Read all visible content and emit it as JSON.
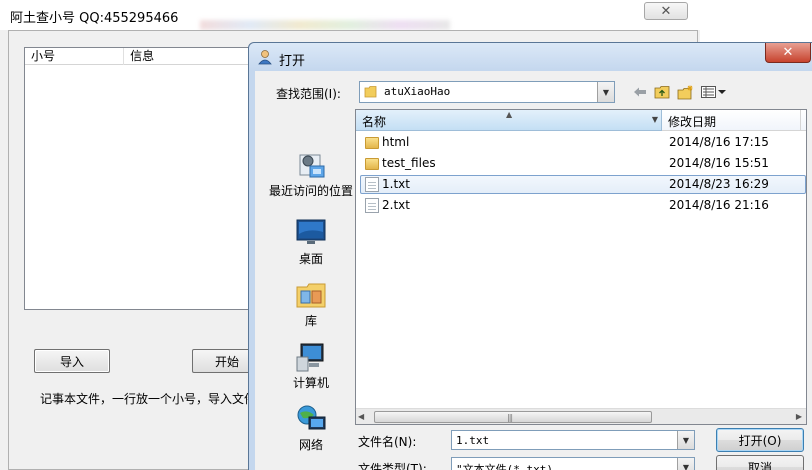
{
  "background_app": {
    "title": "阿土查小号 QQ:455295466",
    "close_glyph": "✕",
    "list_columns": [
      "小号",
      "信息"
    ],
    "import_label": "导入",
    "start_label": "开始",
    "hint": "记事本文件，一行放一个小号，导入文件"
  },
  "dialog": {
    "title": "打开",
    "close_glyph": "✕",
    "look_in_label": "查找范围(I):",
    "look_in_value": "atuXiaoHao",
    "toolbar_icons": [
      "back-arrow-icon",
      "up-folder-icon",
      "new-folder-icon",
      "view-menu-icon"
    ],
    "places": [
      {
        "label": "最近访问的位置",
        "icon": "recent-places-icon"
      },
      {
        "label": "桌面",
        "icon": "desktop-icon"
      },
      {
        "label": "库",
        "icon": "libraries-icon"
      },
      {
        "label": "计算机",
        "icon": "computer-icon"
      },
      {
        "label": "网络",
        "icon": "network-icon"
      }
    ],
    "columns": {
      "name": "名称",
      "date": "修改日期"
    },
    "files": [
      {
        "name": "html",
        "date": "2014/8/16 17:15",
        "type": "folder"
      },
      {
        "name": "test_files",
        "date": "2014/8/16 15:51",
        "type": "folder"
      },
      {
        "name": "1.txt",
        "date": "2014/8/23 16:29",
        "type": "file",
        "selected": true
      },
      {
        "name": "2.txt",
        "date": "2014/8/16 21:16",
        "type": "file"
      }
    ],
    "filename_label": "文件名(N):",
    "filename_value": "1.txt",
    "filetype_label": "文件类型(T):",
    "filetype_value": "\"文本文件(*.txt)",
    "open_label": "打开(O)",
    "cancel_label": "取消"
  }
}
